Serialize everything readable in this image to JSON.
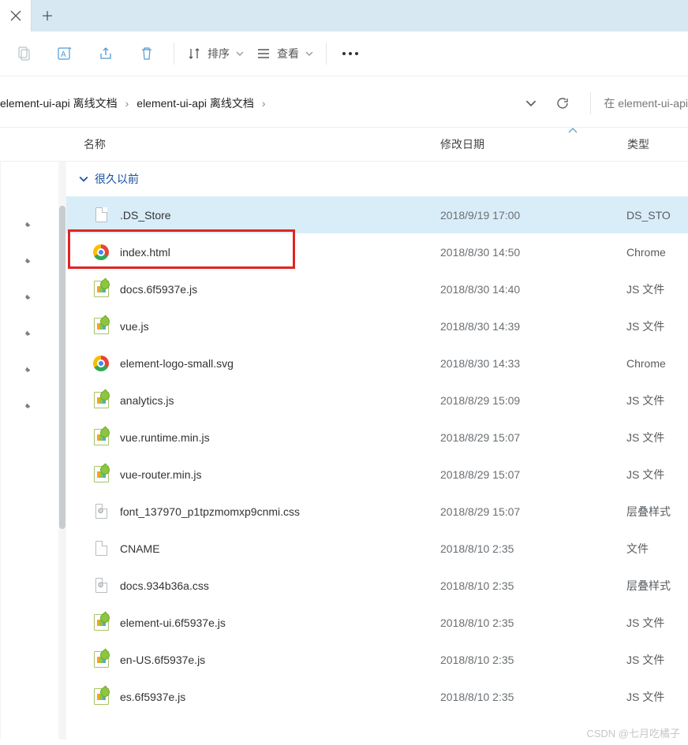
{
  "toolbar": {
    "sort_label": "排序",
    "view_label": "查看"
  },
  "breadcrumb": {
    "items": [
      "element-ui-api 离线文档",
      "element-ui-api 离线文档"
    ]
  },
  "search": {
    "placeholder": "在 element-ui-api"
  },
  "columns": {
    "name": "名称",
    "date": "修改日期",
    "type": "类型"
  },
  "group": {
    "label": "很久以前"
  },
  "files": [
    {
      "name": ".DS_Store",
      "date": "2018/9/19 17:00",
      "type": "DS_STO",
      "icon": "file",
      "selected": true
    },
    {
      "name": "index.html",
      "date": "2018/8/30 14:50",
      "type": "Chrome",
      "icon": "chrome",
      "highlight": true
    },
    {
      "name": "docs.6f5937e.js",
      "date": "2018/8/30 14:40",
      "type": "JS 文件",
      "icon": "js"
    },
    {
      "name": "vue.js",
      "date": "2018/8/30 14:39",
      "type": "JS 文件",
      "icon": "js"
    },
    {
      "name": "element-logo-small.svg",
      "date": "2018/8/30 14:33",
      "type": "Chrome",
      "icon": "chrome"
    },
    {
      "name": "analytics.js",
      "date": "2018/8/29 15:09",
      "type": "JS 文件",
      "icon": "js"
    },
    {
      "name": "vue.runtime.min.js",
      "date": "2018/8/29 15:07",
      "type": "JS 文件",
      "icon": "js"
    },
    {
      "name": "vue-router.min.js",
      "date": "2018/8/29 15:07",
      "type": "JS 文件",
      "icon": "js"
    },
    {
      "name": "font_137970_p1tpzmomxp9cnmi.css",
      "date": "2018/8/29 15:07",
      "type": "层叠样式",
      "icon": "gear"
    },
    {
      "name": "CNAME",
      "date": "2018/8/10 2:35",
      "type": "文件",
      "icon": "file"
    },
    {
      "name": "docs.934b36a.css",
      "date": "2018/8/10 2:35",
      "type": "层叠样式",
      "icon": "gear"
    },
    {
      "name": "element-ui.6f5937e.js",
      "date": "2018/8/10 2:35",
      "type": "JS 文件",
      "icon": "js"
    },
    {
      "name": "en-US.6f5937e.js",
      "date": "2018/8/10 2:35",
      "type": "JS 文件",
      "icon": "js"
    },
    {
      "name": "es.6f5937e.js",
      "date": "2018/8/10 2:35",
      "type": "JS 文件",
      "icon": "js"
    }
  ],
  "watermark": "CSDN @七月吃橘子"
}
